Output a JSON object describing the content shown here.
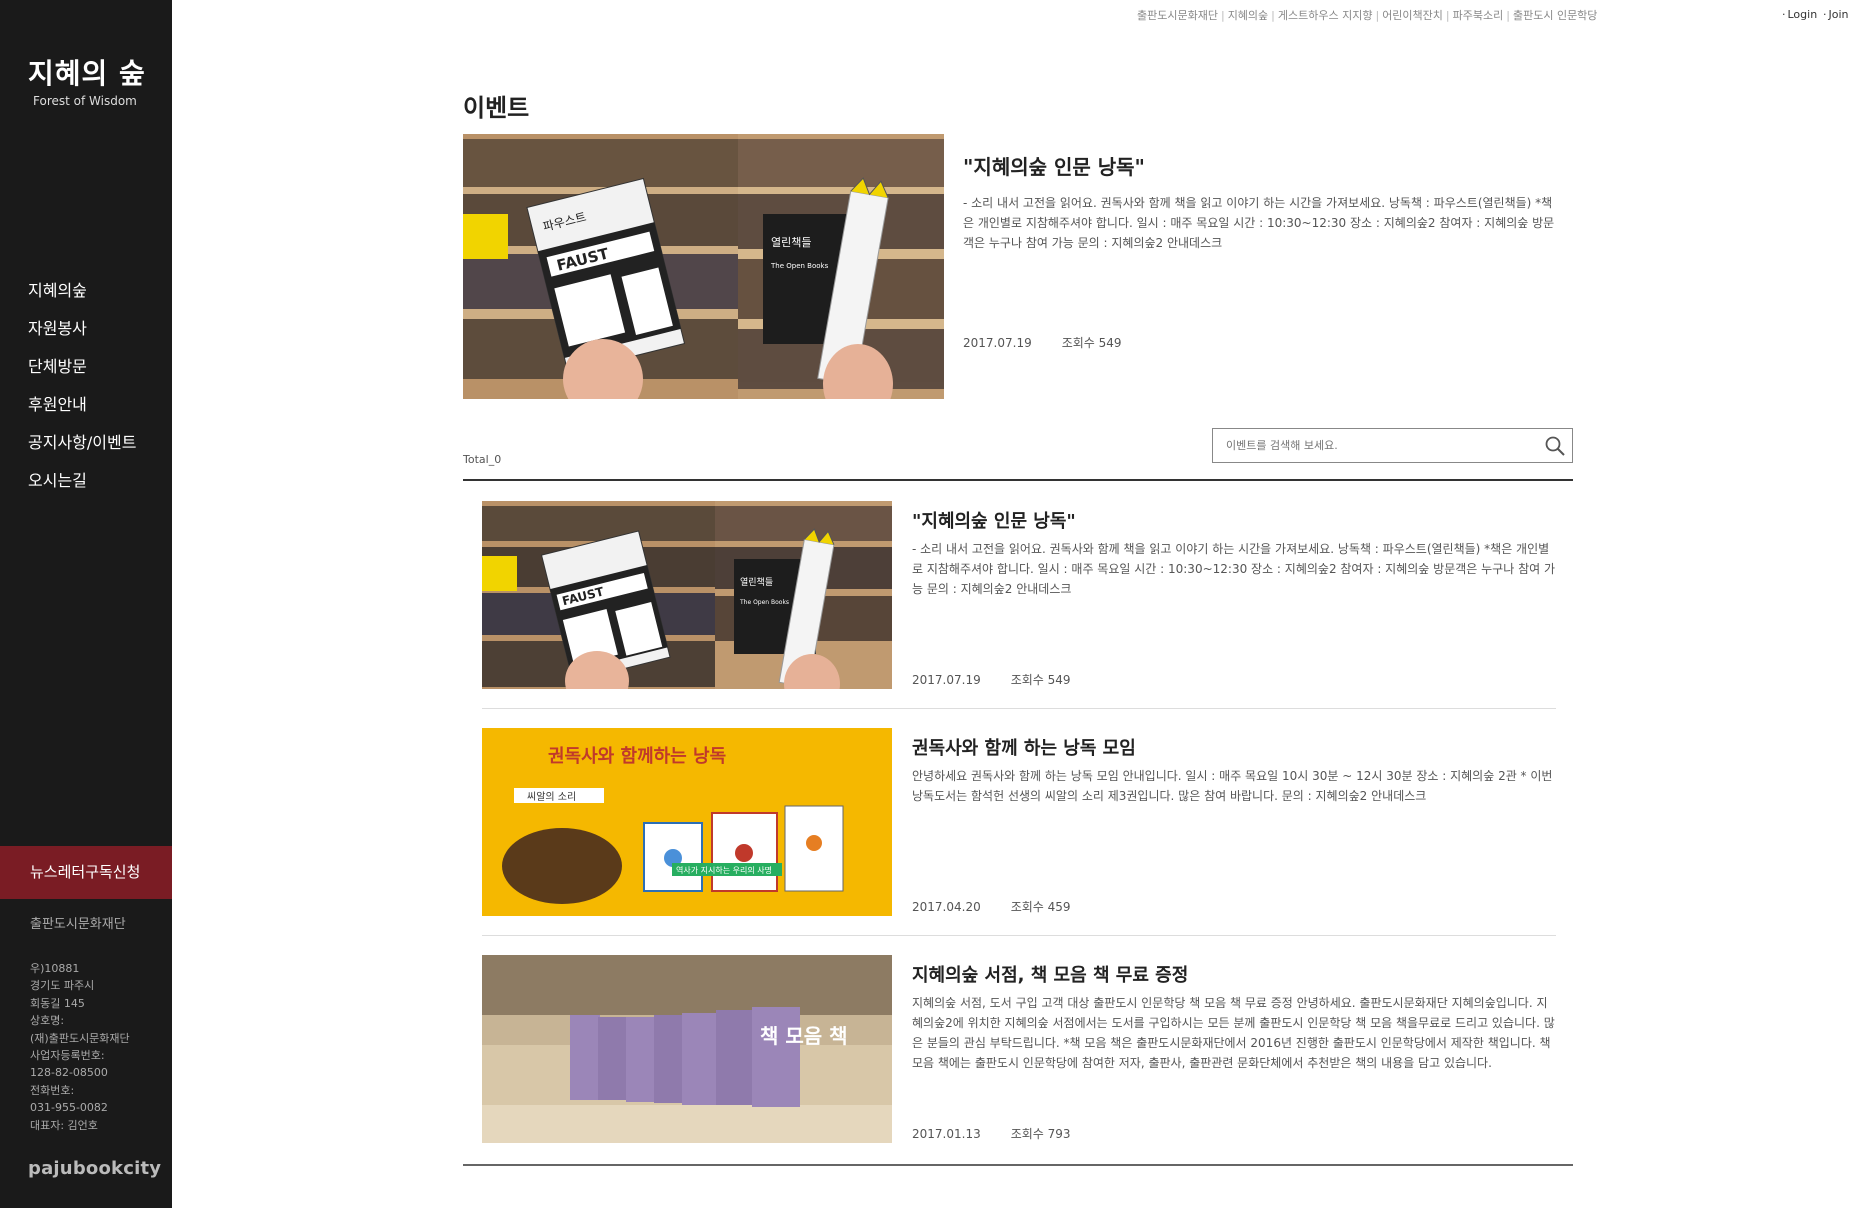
{
  "sidebar": {
    "logo_ko": "지혜의 숲",
    "logo_en": "Forest of Wisdom",
    "nav": [
      "지혜의숲",
      "자원봉사",
      "단체방문",
      "후원안내",
      "공지사항/이벤트",
      "오시는길"
    ],
    "newsletter": "뉴스레터구독신청",
    "foundation": "출판도시문화재단",
    "address": [
      "우)10881",
      "경기도 파주시",
      "회동길 145",
      "상호명:",
      "(재)출판도시문화재단",
      "사업자등록번호:",
      "128-82-08500",
      "전화번호:",
      "031-955-0082",
      "대표자: 김언호"
    ],
    "brand": "pajubookcity"
  },
  "top": {
    "links": [
      "출판도시문화재단",
      "지혜의숲",
      "게스트하우스 지지향",
      "어린이책잔치",
      "파주북소리",
      "출판도시 인문학당"
    ],
    "login": "Login",
    "join": "Join"
  },
  "main": {
    "title": "이벤트",
    "feature": {
      "title": "\"지혜의숲 인문 낭독\"",
      "desc": "- 소리 내서 고전을 읽어요. 권독사와 함께 책을 읽고 이야기 하는 시간을 가져보세요. 낭독책 : 파우스트(열린책들) *책은 개인별로 지참해주셔야 합니다. 일시 : 매주 목요일 시간 : 10:30~12:30 장소 : 지혜의숲2 참여자 : 지혜의숲 방문객은 누구나 참여 가능 문의 : 지혜의숲2 안내데스크",
      "date": "2017.07.19",
      "views": "조회수 549"
    },
    "total": "Total_0",
    "search_placeholder": "이벤트를 검색해 보세요.",
    "items": [
      {
        "title": "\"지혜의숲 인문 낭독\"",
        "desc": "- 소리 내서 고전을 읽어요. 권독사와 함께 책을 읽고 이야기 하는 시간을 가져보세요. 낭독책 : 파우스트(열린책들) *책은 개인별로 지참해주셔야 합니다. 일시 : 매주 목요일 시간 : 10:30~12:30 장소 : 지혜의숲2 참여자 : 지혜의숲 방문객은 누구나 참여 가능 문의 : 지혜의숲2 안내데스크",
        "date": "2017.07.19",
        "views": "조회수 549"
      },
      {
        "title": "권독사와 함께 하는 낭독 모임",
        "desc": "안녕하세요 권독사와 함께 하는 낭독 모임 안내입니다. 일시 : 매주 목요일 10시 30분 ~ 12시 30분 장소 : 지혜의숲 2관 * 이번 낭독도서는 함석헌 선생의 씨알의 소리 제3권입니다. 많은 참여 바랍니다. 문의 : 지혜의숲2 안내데스크",
        "date": "2017.04.20",
        "views": "조회수 459"
      },
      {
        "title": "지혜의숲 서점, 책 모음 책 무료 증정",
        "desc": "지혜의숲 서점, 도서 구입 고객 대상 출판도시 인문학당 책 모음 책 무료 증정 안녕하세요. 출판도시문화재단 지혜의숲입니다. 지혜의숲2에 위치한 지혜의숲 서점에서는 도서를 구입하시는 모든 분께 출판도시 인문학당 책 모음 책을무료로 드리고 있습니다. 많은 분들의 관심 부탁드립니다. *책 모음 책은 출판도시문화재단에서 2016년 진행한 출판도시 인문학당에서 제작한 책입니다. 책 모음 책에는 출판도시 인문학당에 참여한 저자, 출판사, 출판관련 문화단체에서 추천받은 책의 내용을 담고 있습니다.",
        "date": "2017.01.13",
        "views": "조회수 793"
      }
    ],
    "poster": {
      "headline": "권독사와 함께하는 낭독",
      "subtitle": "씨알의 소리",
      "banner": "역사가 지시하는 우리의 사명"
    },
    "book_covers": {
      "left": "파우스트",
      "left_en": "FAUST",
      "right": "열린책들",
      "right_en": "The Open Books",
      "spine": "책 모음 책"
    }
  }
}
